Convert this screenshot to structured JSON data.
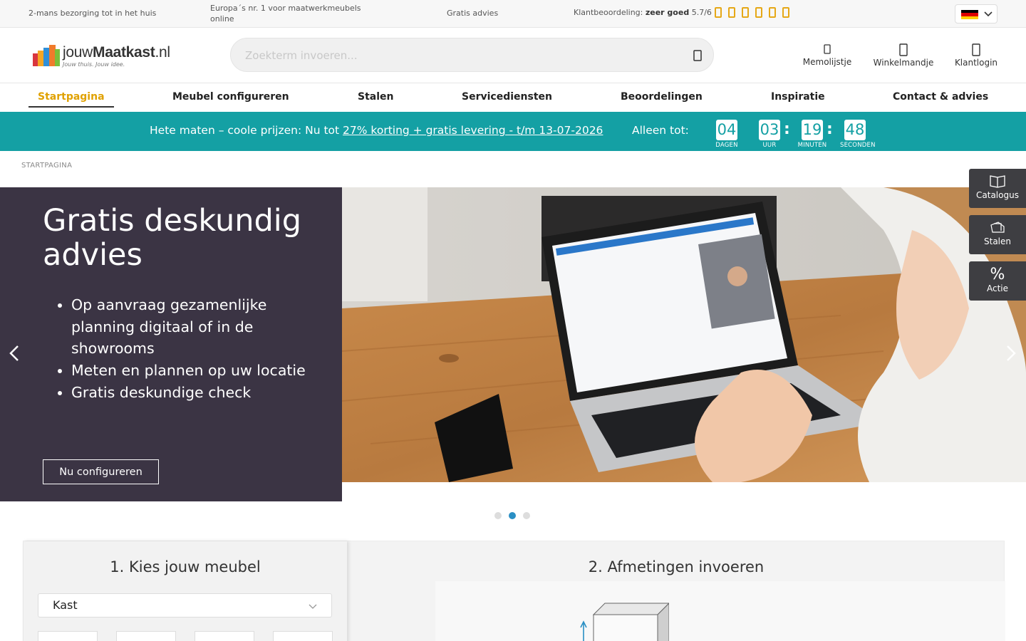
{
  "topbar": {
    "delivery": "2-mans bezorging tot in het huis",
    "europe": "Europa´s nr. 1 voor maatwerkmeubels online",
    "advice": "Gratis advies",
    "rating_prefix": "Klantbeoordeling:",
    "rating_word": "zeer goed",
    "rating_value": "5.7/6",
    "star_icon": "star-outline-icon",
    "language_flag": "german-flag-icon"
  },
  "header": {
    "logo_name_light": "jouw",
    "logo_name_bold": "Maatkast",
    "logo_name_tld": ".nl",
    "logo_tagline": "Jouw thuis. Jouw idee.",
    "search_placeholder": "Zoekterm invoeren...",
    "memo_label": "Memolijstje",
    "cart_label": "Winkelmandje",
    "login_label": "Klantlogin"
  },
  "nav": {
    "items": [
      {
        "label": "Startpagina"
      },
      {
        "label": "Meubel configureren"
      },
      {
        "label": "Stalen"
      },
      {
        "label": "Servicediensten"
      },
      {
        "label": "Beoordelingen"
      },
      {
        "label": "Inspiratie"
      },
      {
        "label": "Contact & advies"
      }
    ],
    "active_color": "#e0a100"
  },
  "promo": {
    "text": "Hete maten – coole prijzen: Nu tot",
    "link": "27% korting + gratis levering - t/m 13-07-2026",
    "until": "Alleen tot:",
    "countdown": [
      {
        "value": "04",
        "label": "DAGEN"
      },
      {
        "value": "03",
        "label": "UUR"
      },
      {
        "value": "19",
        "label": "MINUTEN"
      },
      {
        "value": "48",
        "label": "SECONDEN"
      }
    ],
    "background": "#14a0a4"
  },
  "breadcrumb": "STARTPAGINA",
  "hero": {
    "title": "Gratis deskundig advies",
    "bullets": [
      "Op aanvraag gezamenlijke planning digitaal of in de showrooms",
      "Meten en plannen op uw locatie",
      "Gratis deskundige check"
    ],
    "button": "Nu configureren",
    "panel_color": "#3b3444",
    "active_slide": 2,
    "slide_count": 3
  },
  "side": {
    "catalogus": "Catalogus",
    "stalen": "Stalen",
    "actie_symbol": "%",
    "actie": "Actie"
  },
  "configurator": {
    "step1": "1. Kies jouw meubel",
    "select_value": "Kast",
    "step2": "2. Afmetingen invoeren"
  }
}
